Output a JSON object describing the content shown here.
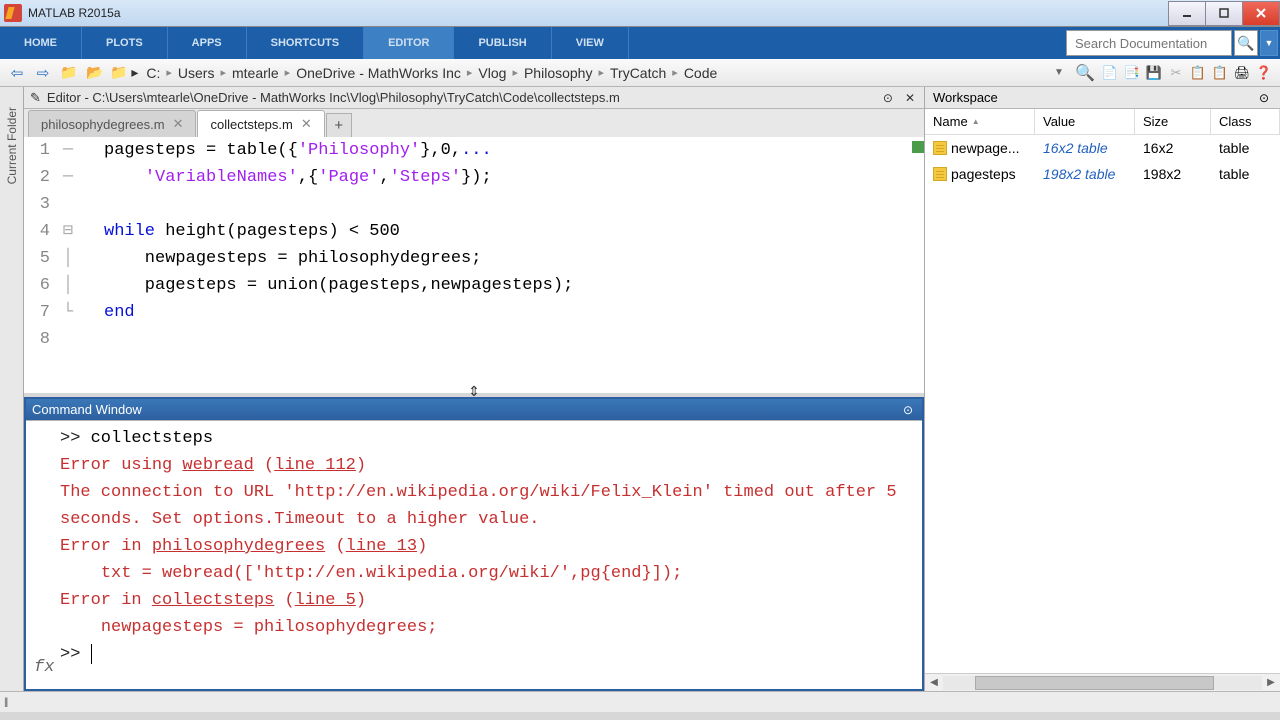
{
  "title": "MATLAB R2015a",
  "tabs": [
    "HOME",
    "PLOTS",
    "APPS",
    "SHORTCUTS",
    "EDITOR",
    "PUBLISH",
    "VIEW"
  ],
  "search": {
    "placeholder": "Search Documentation"
  },
  "breadcrumb": [
    "C:",
    "Users",
    "mtearle",
    "OneDrive - MathWorks Inc",
    "Vlog",
    "Philosophy",
    "TryCatch",
    "Code"
  ],
  "sidebar": "Current Folder",
  "editor": {
    "title": "Editor - C:\\Users\\mtearle\\OneDrive - MathWorks Inc\\Vlog\\Philosophy\\TryCatch\\Code\\collectsteps.m",
    "tabs": [
      {
        "name": "philosophydegrees.m",
        "active": false
      },
      {
        "name": "collectsteps.m",
        "active": true
      }
    ],
    "lines": [
      "1",
      "2",
      "3",
      "4",
      "5",
      "6",
      "7",
      "8"
    ],
    "code": {
      "l1a": "pagesteps = table({",
      "l1b": "'Philosophy'",
      "l1c": "},0,",
      "l1d": "...",
      "l2a": "    ",
      "l2b": "'VariableNames'",
      "l2c": ",{",
      "l2d": "'Page'",
      "l2e": ",",
      "l2f": "'Steps'",
      "l2g": "});",
      "l4a": "while",
      "l4b": " height(pagesteps) < 500",
      "l5": "    newpagesteps = philosophydegrees;",
      "l6": "    pagesteps = union(pagesteps,newpagesteps);",
      "l7": "end"
    }
  },
  "command": {
    "title": "Command Window",
    "prompt": ">> ",
    "input": "collectsteps",
    "err1a": "Error using ",
    "err1b": "webread",
    "err1c": " (",
    "err1d": "line 112",
    "err1e": ")",
    "err2": "The connection to URL 'http://en.wikipedia.org/wiki/Felix_Klein' timed out after 5 seconds. Set options.Timeout to a higher value.",
    "err3a": "Error in ",
    "err3b": "philosophydegrees",
    "err3c": " (",
    "err3d": "line 13",
    "err3e": ")",
    "err4": "    txt = webread(['http://en.wikipedia.org/wiki/',pg{end}]);",
    "err5a": "Error in ",
    "err5b": "collectsteps",
    "err5c": " (",
    "err5d": "line 5",
    "err5e": ")",
    "err6": "    newpagesteps = philosophydegrees;",
    "fx": "fx"
  },
  "workspace": {
    "title": "Workspace",
    "cols": {
      "name": "Name",
      "value": "Value",
      "size": "Size",
      "class": "Class"
    },
    "rows": [
      {
        "name": "newpage...",
        "value": "16x2 table",
        "size": "16x2",
        "class": "table"
      },
      {
        "name": "pagesteps",
        "value": "198x2 table",
        "size": "198x2",
        "class": "table"
      }
    ]
  }
}
